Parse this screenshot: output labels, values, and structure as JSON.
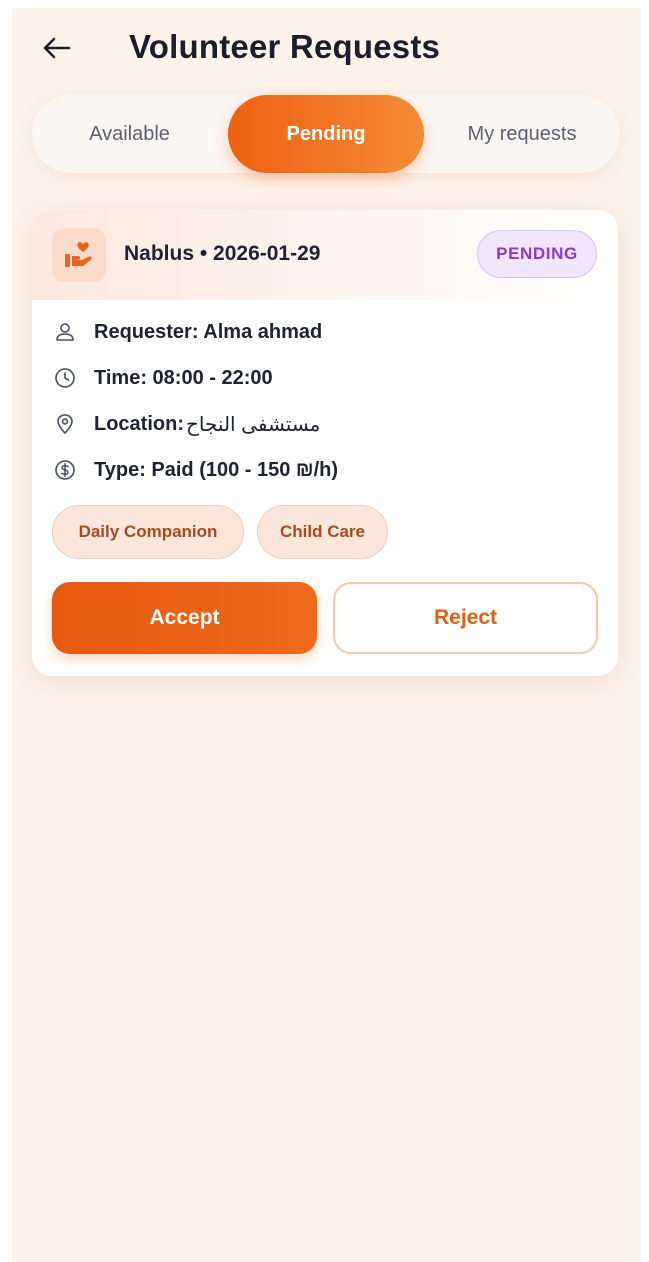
{
  "header": {
    "title": "Volunteer Requests",
    "back_icon": "arrow-left-icon"
  },
  "tabs": [
    {
      "label": "Available",
      "active": false
    },
    {
      "label": "Pending",
      "active": true
    },
    {
      "label": "My requests",
      "active": false
    }
  ],
  "request": {
    "category_icon": "hand-heart-icon",
    "title": "Nablus • 2026-01-29",
    "status": "PENDING",
    "requester": "Requester: Alma ahmad",
    "time": "Time: 08:00 - 22:00",
    "location_label": "Location:",
    "location_value": "مستشفى النجاح",
    "type": "Type: Paid (100 - 150 ₪/h)",
    "tags": [
      "Daily Companion",
      "Child Care"
    ],
    "accept_label": "Accept",
    "reject_label": "Reject"
  },
  "colors": {
    "accent": "#ee6213",
    "background": "#fdf3eb",
    "status_purple": "#8a38d6",
    "chip_text": "#a84b1c"
  }
}
